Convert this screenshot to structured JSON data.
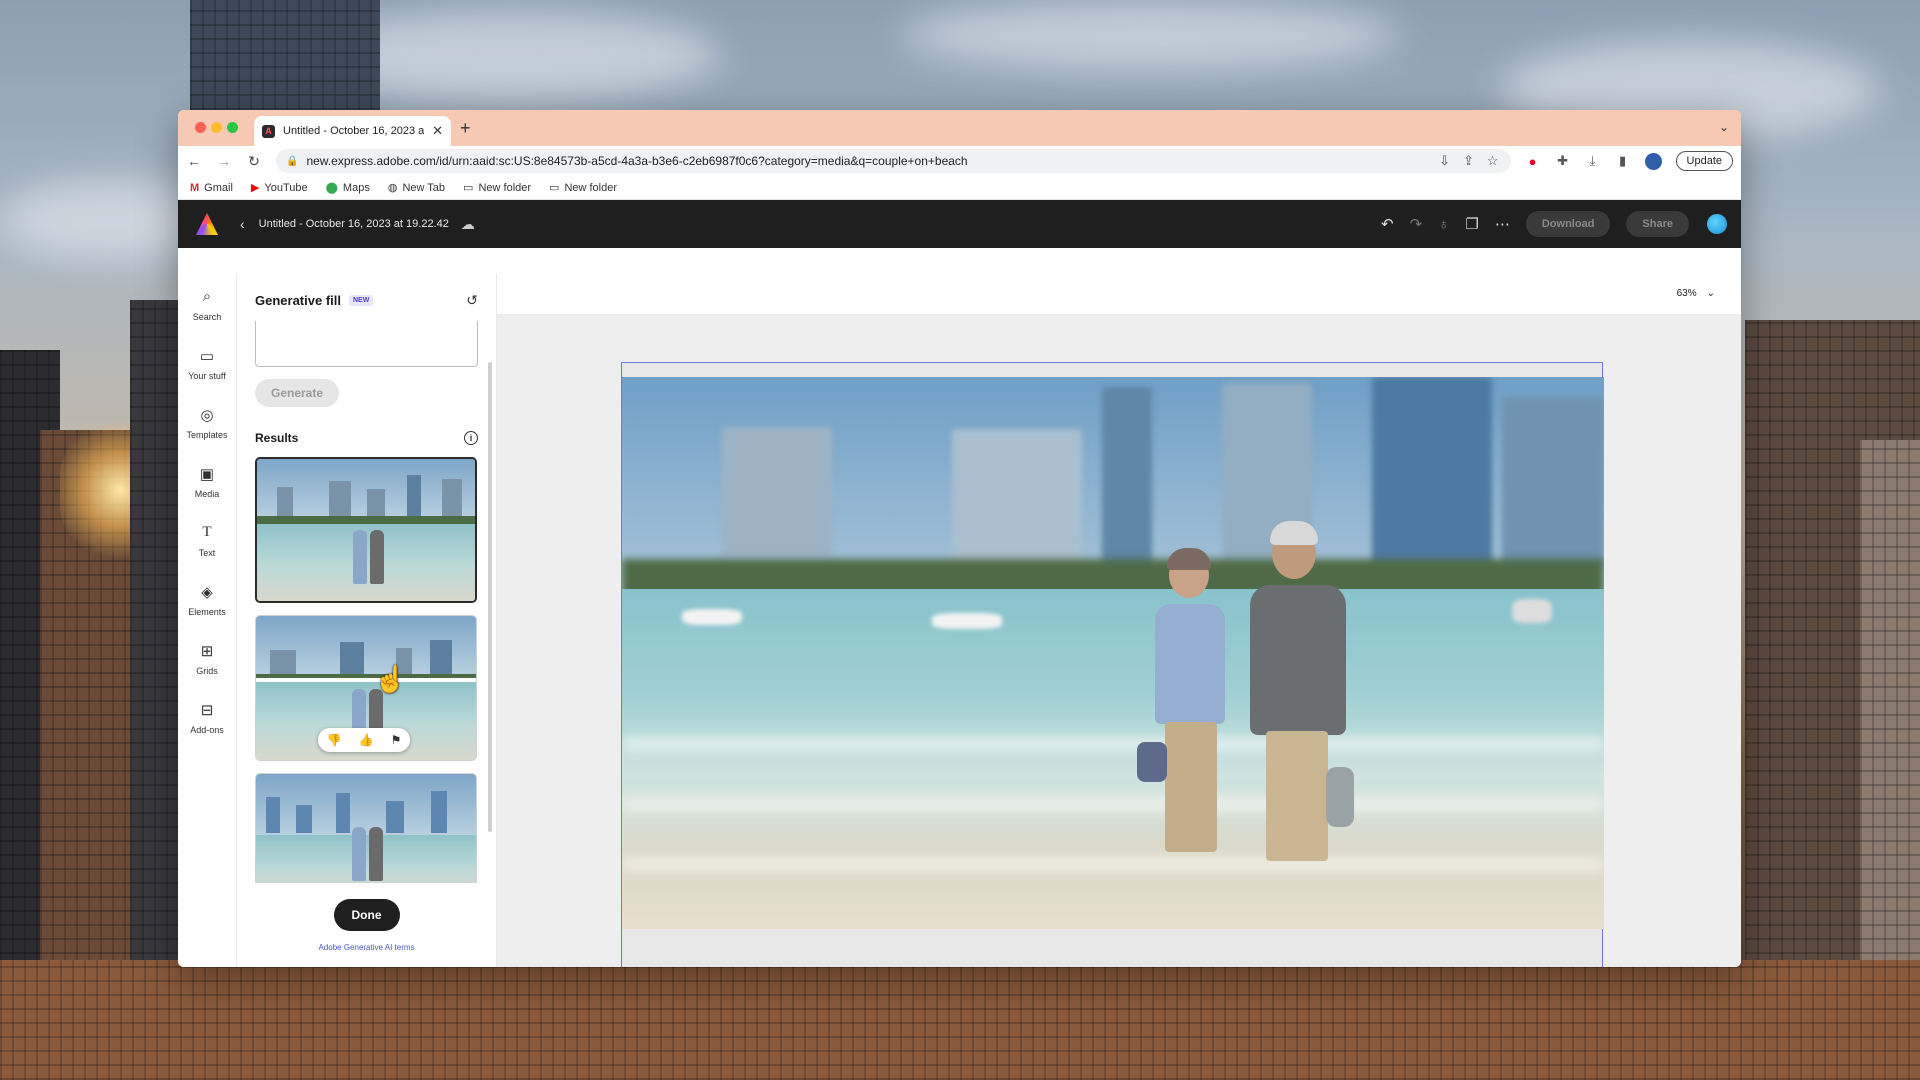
{
  "browser": {
    "tab_title": "Untitled - October 16, 2023 at",
    "url": "new.express.adobe.com/id/urn:aaid:sc:US:8e84573b-a5cd-4a3a-b3e6-c2eb6987f0c6?category=media&q=couple+on+beach",
    "update_label": "Update",
    "bookmarks": [
      {
        "label": "Gmail"
      },
      {
        "label": "YouTube"
      },
      {
        "label": "Maps"
      },
      {
        "label": "New Tab"
      },
      {
        "label": "New folder"
      },
      {
        "label": "New folder"
      }
    ]
  },
  "appbar": {
    "doc_title": "Untitled - October 16, 2023 at 19.22.42",
    "download_label": "Download",
    "share_label": "Share"
  },
  "rail": {
    "items": [
      {
        "label": "Search",
        "icon": "search-icon"
      },
      {
        "label": "Your stuff",
        "icon": "folder-icon"
      },
      {
        "label": "Templates",
        "icon": "templates-icon"
      },
      {
        "label": "Media",
        "icon": "media-icon"
      },
      {
        "label": "Text",
        "icon": "text-icon"
      },
      {
        "label": "Elements",
        "icon": "elements-icon"
      },
      {
        "label": "Grids",
        "icon": "grids-icon"
      },
      {
        "label": "Add-ons",
        "icon": "addons-icon"
      }
    ]
  },
  "panel": {
    "title": "Generative fill",
    "badge": "NEW",
    "generate_label": "Generate",
    "results_title": "Results",
    "done_label": "Done",
    "terms_link": "Adobe Generative AI terms"
  },
  "canvas": {
    "zoom": "63%"
  },
  "colors": {
    "tab_bar": "#f7c8b4",
    "app_bar": "#1f1f1f",
    "selection_border": "#6d78e6",
    "terms_link": "#4b56d2"
  }
}
